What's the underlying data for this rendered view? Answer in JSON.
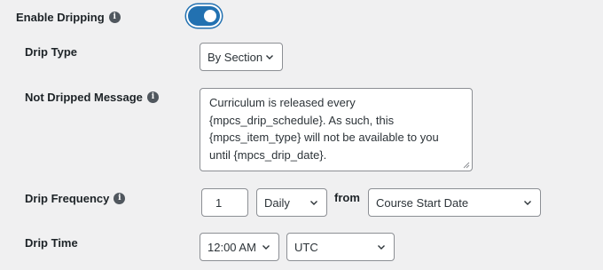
{
  "enable_dripping": {
    "label": "Enable Dripping",
    "enabled": true
  },
  "drip_type": {
    "label": "Drip Type",
    "value": "By Section"
  },
  "not_dripped_message": {
    "label": "Not Dripped Message",
    "lines": [
      "Curriculum is released every",
      "{mpcs_drip_schedule}. As such, this",
      "{mpcs_item_type} will not be available to you",
      "until {mpcs_drip_date}."
    ]
  },
  "drip_frequency": {
    "label": "Drip Frequency",
    "amount": "1",
    "unit": "Daily",
    "from_label": "from",
    "from_value": "Course Start Date"
  },
  "drip_time": {
    "label": "Drip Time",
    "time": "12:00 AM",
    "timezone": "UTC"
  },
  "colors": {
    "accent": "#2271b1",
    "background": "#f0f0f1",
    "icon": "#50575e"
  },
  "icons": {
    "info": "info-icon",
    "dropdown": "chevron-down-icon",
    "resize": "resize-grip-icon"
  }
}
